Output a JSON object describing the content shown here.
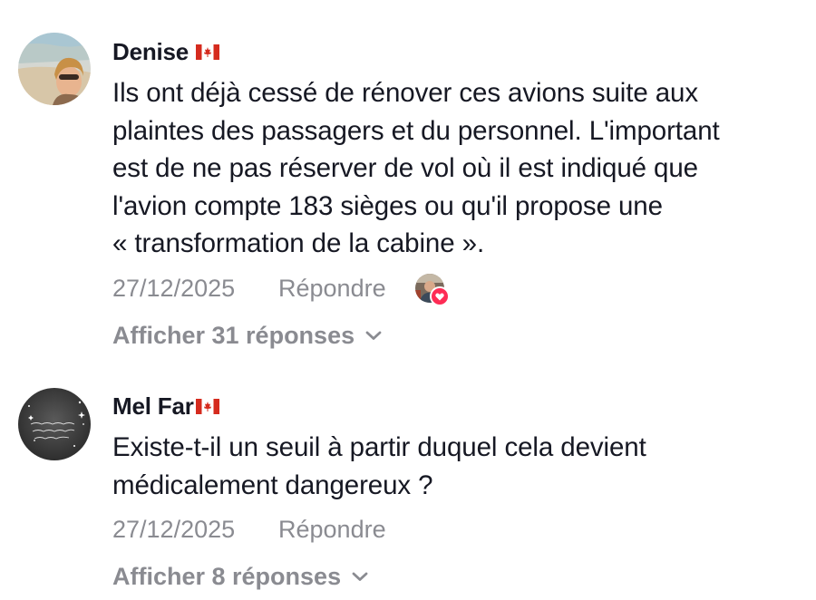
{
  "comments": [
    {
      "username": "Denise",
      "flag_icon": "canada-flag-icon",
      "text_lines": [
        "Ils ont déjà cessé de rénover ces avions suite aux",
        "plaintes des passagers et du personnel. L'important",
        "est de ne pas réserver de vol où il est indiqué que",
        "l'avion compte 183 sièges ou qu'il propose une",
        "« transformation de la cabine »."
      ],
      "date": "27/12/2025",
      "reply_label": "Répondre",
      "view_replies": "Afficher 31 réponses",
      "liked_by_creator": true
    },
    {
      "username": "Mel Far",
      "flag_icon": "canada-flag-icon",
      "text_lines": [
        "Existe-t-il un seuil à partir duquel cela devient",
        "médicalement dangereux ?"
      ],
      "date": "27/12/2025",
      "reply_label": "Répondre",
      "view_replies": "Afficher 8 réponses",
      "liked_by_creator": false
    }
  ],
  "colors": {
    "text_primary": "#161823",
    "text_secondary": "#8a8b91",
    "heart_badge": "#fe2c55",
    "flag_red": "#d52b1e"
  }
}
